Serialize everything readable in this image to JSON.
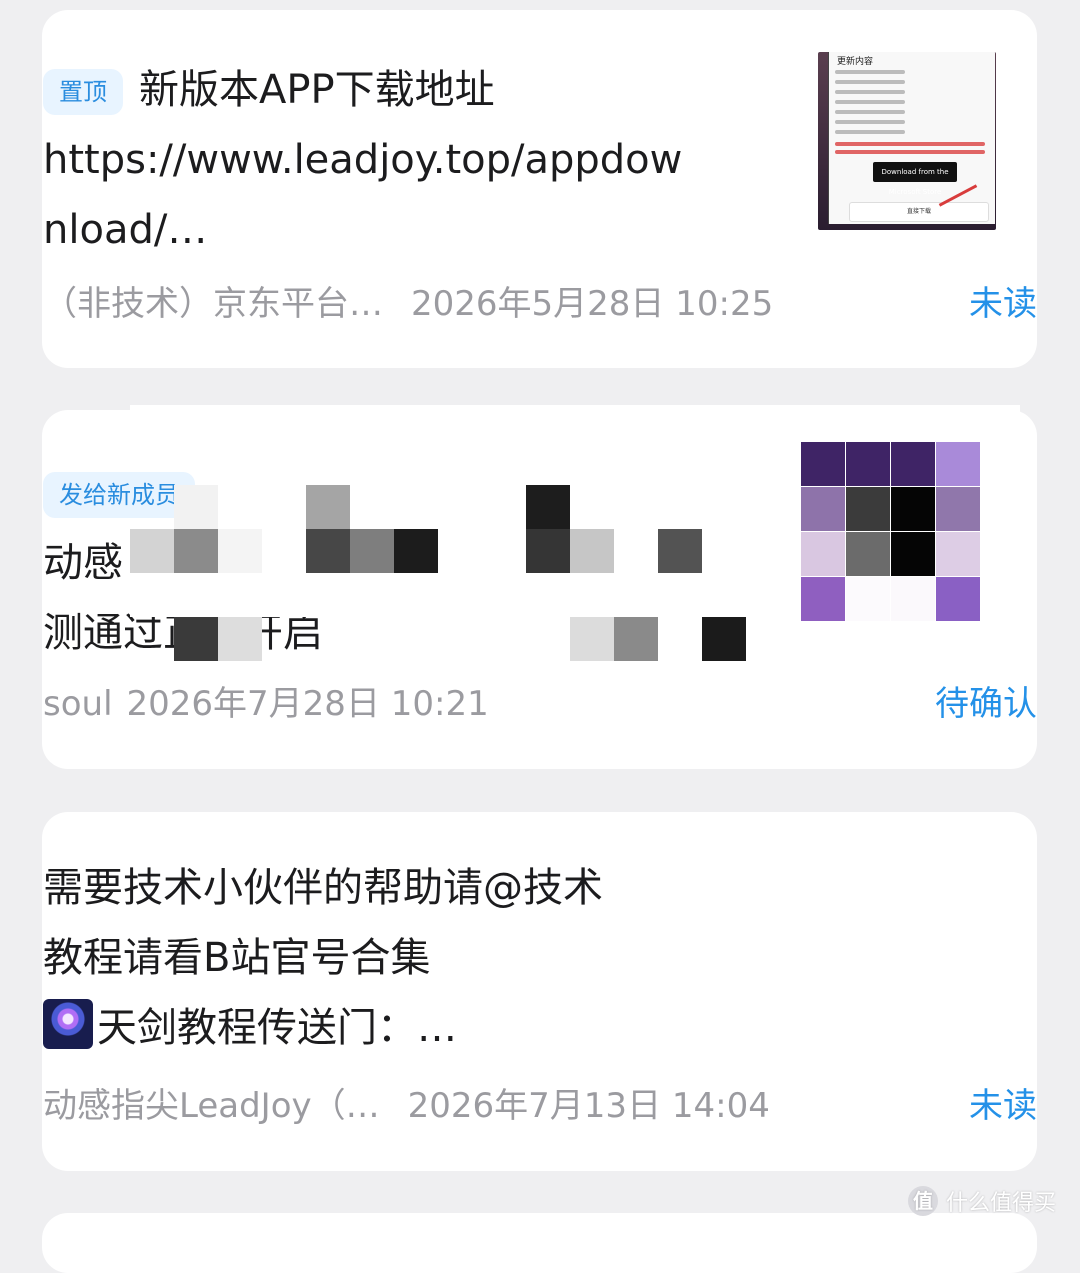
{
  "cards": [
    {
      "tag": "置顶",
      "lines": [
        "新版本APP下载地址",
        "https://www.leadjoy.top/appdow",
        "nload/…"
      ],
      "group": "（非技术）京东平台…",
      "time": "2026年5月28日 10:25",
      "status": "未读",
      "thumb": {
        "heading": "更新内容",
        "store_button": "Download from the Microsoft Store",
        "download_label": "直接下载"
      }
    },
    {
      "tag": "发给新成员",
      "lines": [
        "动感",
        "测通过正式开启"
      ],
      "group": "soul",
      "time": "2026年7月28日 10:21",
      "status": "待确认"
    },
    {
      "lines": [
        "需要技术小伙伴的帮助请@技术",
        "教程请看B站官号合集",
        "天剑教程传送门：…"
      ],
      "group": "动感指尖LeadJoy（…",
      "time": "2026年7月13日 14:04",
      "status": "未读",
      "emoji_icon": "fireworks-icon"
    }
  ],
  "watermark": {
    "logo": "值",
    "text": "什么值得买"
  },
  "colors": {
    "background": "#efeff1",
    "card": "#ffffff",
    "text": "#1c1c1e",
    "meta": "#9b9ba0",
    "status": "#2491e8",
    "tag_bg": "#e8f4ff",
    "tag_text": "#2a8ddf"
  }
}
